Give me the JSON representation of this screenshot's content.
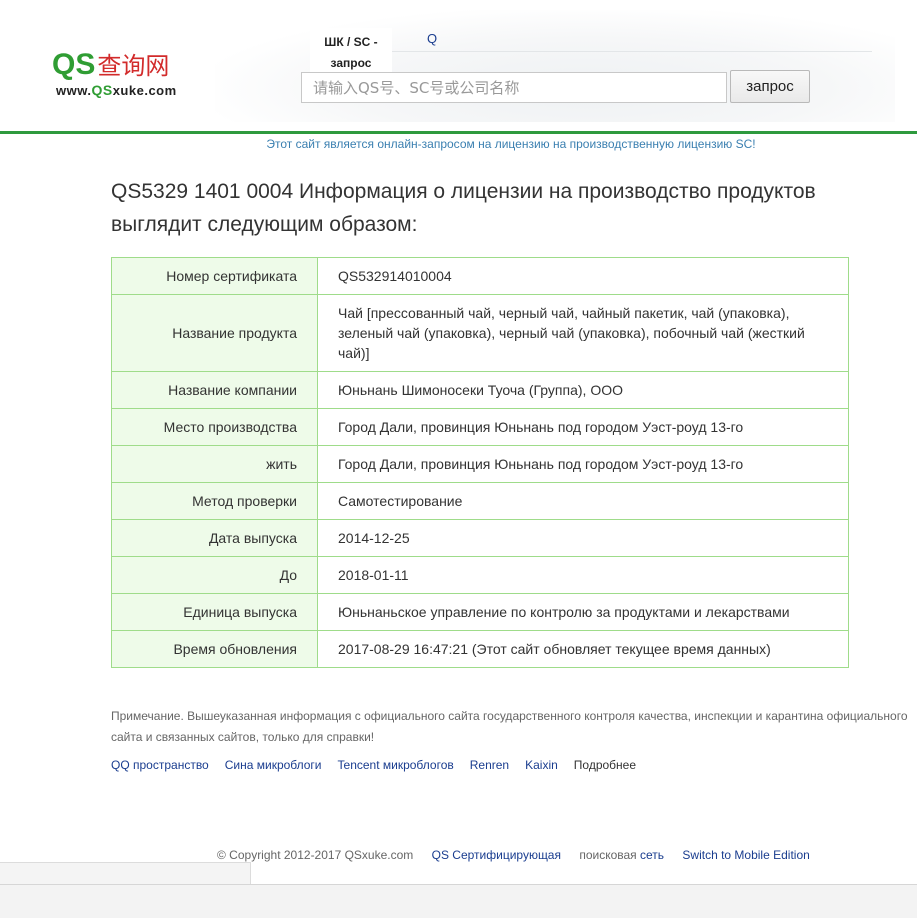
{
  "header": {
    "logo": {
      "mark": "QS",
      "cn": "查询网",
      "url_prefix": "www.",
      "url_highlight": "QS",
      "url_suffix": "xuke.com"
    },
    "tabs": [
      {
        "label": "ШК / SC - запрос"
      },
      {
        "label": "Q"
      }
    ],
    "search": {
      "placeholder": "请输入QS号、SC号或公司名称",
      "value": ""
    },
    "search_button": "запрос"
  },
  "notice": "Этот сайт является онлайн-запросом на лицензию на производственную лицензию SC!",
  "page_title": "QS5329 1401 0004 Информация о лицензии на производство продуктов выглядит следующим образом:",
  "table": {
    "rows": [
      {
        "label": "Номер сертификата",
        "value": "QS532914010004"
      },
      {
        "label": "Название продукта",
        "value": "Чай [прессованный чай, черный чай, чайный пакетик, чай (упаковка), зеленый чай (упаковка), черный чай (упаковка), побочный чай (жесткий чай)]"
      },
      {
        "label": "Название компании",
        "value": "Юньнань Шимоносеки Туоча (Группа), ООО"
      },
      {
        "label": "Место производства",
        "value": "Город Дали, провинция Юньнань под городом Уэст-роуд 13-го"
      },
      {
        "label": "жить",
        "value": "Город Дали, провинция Юньнань под городом Уэст-роуд 13-го"
      },
      {
        "label": "Метод проверки",
        "value": "Самотестирование"
      },
      {
        "label": "Дата выпуска",
        "value": "2014-12-25"
      },
      {
        "label": "До",
        "value": "2018-01-11"
      },
      {
        "label": "Единица выпуска",
        "value": "Юньнаньское управление по контролю за продуктами и лекарствами"
      },
      {
        "label": "Время обновления",
        "value": "2017-08-29 16:47:21 (Этот сайт обновляет текущее время данных)"
      }
    ]
  },
  "note": "Примечание. Вышеуказанная информация с официального сайта государственного контроля качества, инспекции и карантина официального сайта и связанных сайтов, только для справки!",
  "share": {
    "links": [
      "QQ пространство",
      "Сина микроблоги",
      "Tencent микроблогов",
      "Renren",
      "Kaixin"
    ],
    "more": "Подробнее"
  },
  "footer": {
    "copyright": "© Copyright 2012-2017 QSxuke.com",
    "links": [
      "QS Сертифицирующая",
      "сеть",
      "Switch to Mobile Edition"
    ],
    "middle_text": "поисковая"
  },
  "colors": {
    "brand_green": "#2f9d33",
    "divider_green": "#2e9a3e",
    "link_blue": "#1a3d8f",
    "logo_red": "#d22b2b",
    "table_border": "#9fdc8a",
    "label_bg": "#eefbe9"
  }
}
